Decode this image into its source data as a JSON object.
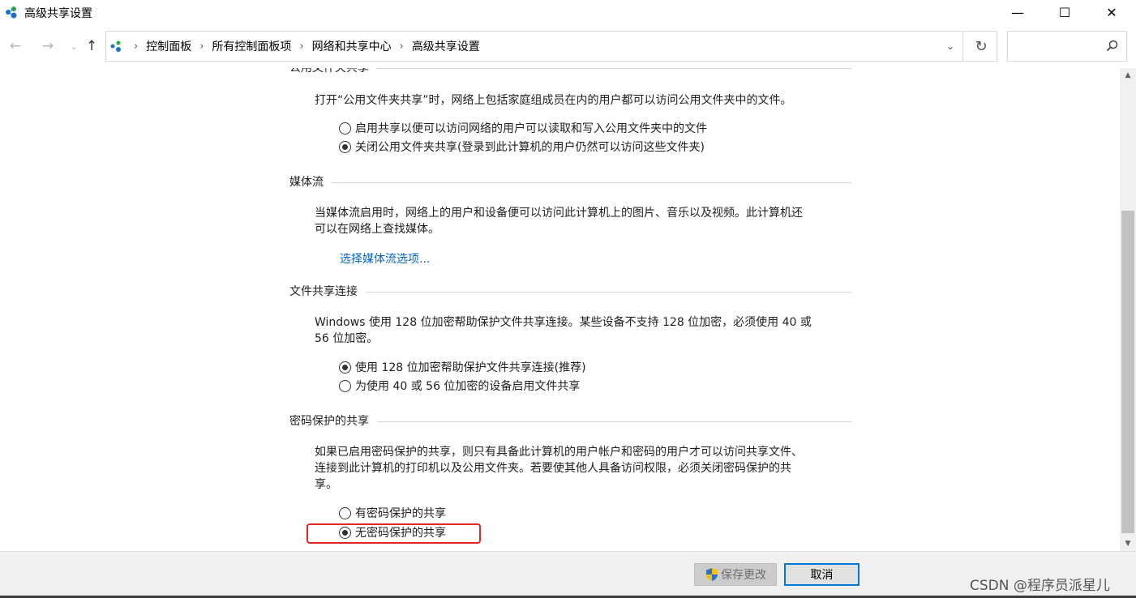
{
  "window": {
    "title": "高级共享设置",
    "controls": {
      "minimize": "—",
      "maximize": "☐",
      "close": "✕"
    }
  },
  "nav": {
    "back_icon": "←",
    "forward_icon": "→",
    "recent_icon": "⌄",
    "up_icon": "↑",
    "breadcrumbs": [
      "控制面板",
      "所有控制面板项",
      "网络和共享中心",
      "高级共享设置"
    ],
    "search_placeholder": "",
    "refresh_icon": "↻",
    "dropdown_icon": "⌄"
  },
  "sections": {
    "public_folder": {
      "title": "公用文件夹共享",
      "description": "打开“公用文件夹共享”时，网络上包括家庭组成员在内的用户都可以访问公用文件夹中的文件。",
      "options": [
        {
          "label": "启用共享以便可以访问网络的用户可以读取和写入公用文件夹中的文件",
          "selected": false
        },
        {
          "label": "关闭公用文件夹共享(登录到此计算机的用户仍然可以访问这些文件夹)",
          "selected": true
        }
      ]
    },
    "media": {
      "title": "媒体流",
      "description_line1": "当媒体流启用时，网络上的用户和设备便可以访问此计算机上的图片、音乐以及视频。此计算机还",
      "description_line2": "可以在网络上查找媒体。",
      "link": "选择媒体流选项..."
    },
    "file_sharing": {
      "title": "文件共享连接",
      "description_line1": "Windows 使用 128 位加密帮助保护文件共享连接。某些设备不支持 128 位加密，必须使用 40 或",
      "description_line2": "56 位加密。",
      "options": [
        {
          "label": "使用 128 位加密帮助保护文件共享连接(推荐)",
          "selected": true
        },
        {
          "label": "为使用 40 或 56 位加密的设备启用文件共享",
          "selected": false
        }
      ]
    },
    "password": {
      "title": "密码保护的共享",
      "description_line1": "如果已启用密码保护的共享，则只有具备此计算机的用户帐户和密码的用户才可以访问共享文件、",
      "description_line2": "连接到此计算机的打印机以及公用文件夹。若要使其他人具备访问权限，必须关闭密码保护的共",
      "description_line3": "享。",
      "options": [
        {
          "label": "有密码保护的共享",
          "selected": false
        },
        {
          "label": "无密码保护的共享",
          "selected": true
        }
      ]
    }
  },
  "footer": {
    "save_label": "保存更改",
    "cancel_label": "取消",
    "watermark": "CSDN @程序员派星儿"
  },
  "colors": {
    "link": "#0066cc",
    "highlight": "#e5261f",
    "focus_border": "#0078d7"
  }
}
